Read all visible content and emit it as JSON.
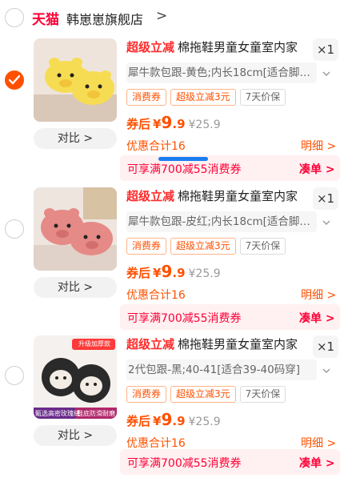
{
  "store": {
    "logo": "天猫",
    "name": "韩崽崽旗舰店",
    "chevron": ">"
  },
  "items": [
    {
      "checked": true,
      "promo": "超级立减",
      "title": "棉拖鞋男童女童室内家",
      "qty": "×1",
      "sku": "犀牛款包跟-黄色;内长18cm[适合脚…",
      "tags": [
        "消费券",
        "超级立减3元",
        "7天价保"
      ],
      "price_label": "券后",
      "currency": "¥",
      "price_int": "9",
      "price_dec": ".9",
      "orig_price": "¥25.9",
      "discount": "优惠合计16",
      "detail": "明细 >",
      "compare": "对比 >",
      "coupon_text": "可享满700减55消费券",
      "coupon_btn": "凑单 >",
      "shoe_color": "#f6dc52"
    },
    {
      "checked": false,
      "promo": "超级立减",
      "title": "棉拖鞋男童女童室内家",
      "qty": "×1",
      "sku": "犀牛款包跟-皮红;内长18cm[适合脚…",
      "tags": [
        "消费券",
        "超级立减3元",
        "7天价保"
      ],
      "price_label": "券后",
      "currency": "¥",
      "price_int": "9",
      "price_dec": ".9",
      "orig_price": "¥25.9",
      "discount": "优惠合计16",
      "detail": "明细 >",
      "compare": "对比 >",
      "coupon_text": "可享满700减55消费券",
      "coupon_btn": "凑单 >",
      "shoe_color": "#e58a86"
    },
    {
      "checked": false,
      "promo": "超级立减",
      "title": "棉拖鞋男童女童室内家",
      "qty": "×1",
      "sku": "2代包跟-黑;40-41[适合39-40码穿]",
      "tags": [
        "消费券",
        "超级立减3元",
        "7天价保"
      ],
      "price_label": "券后",
      "currency": "¥",
      "price_int": "9",
      "price_dec": ".9",
      "orig_price": "¥25.9",
      "discount": "优惠合计16",
      "detail": "明细 >",
      "compare": "对比 >",
      "coupon_text": "可享满700减55消费券",
      "coupon_btn": "凑单 >",
      "shoe_color": "#2a2a2a",
      "image_badge": "升级加厚款",
      "image_footer_left": "甄选高密玫瑰绒",
      "image_footer_right": "鞋底防滑耐磨"
    }
  ]
}
